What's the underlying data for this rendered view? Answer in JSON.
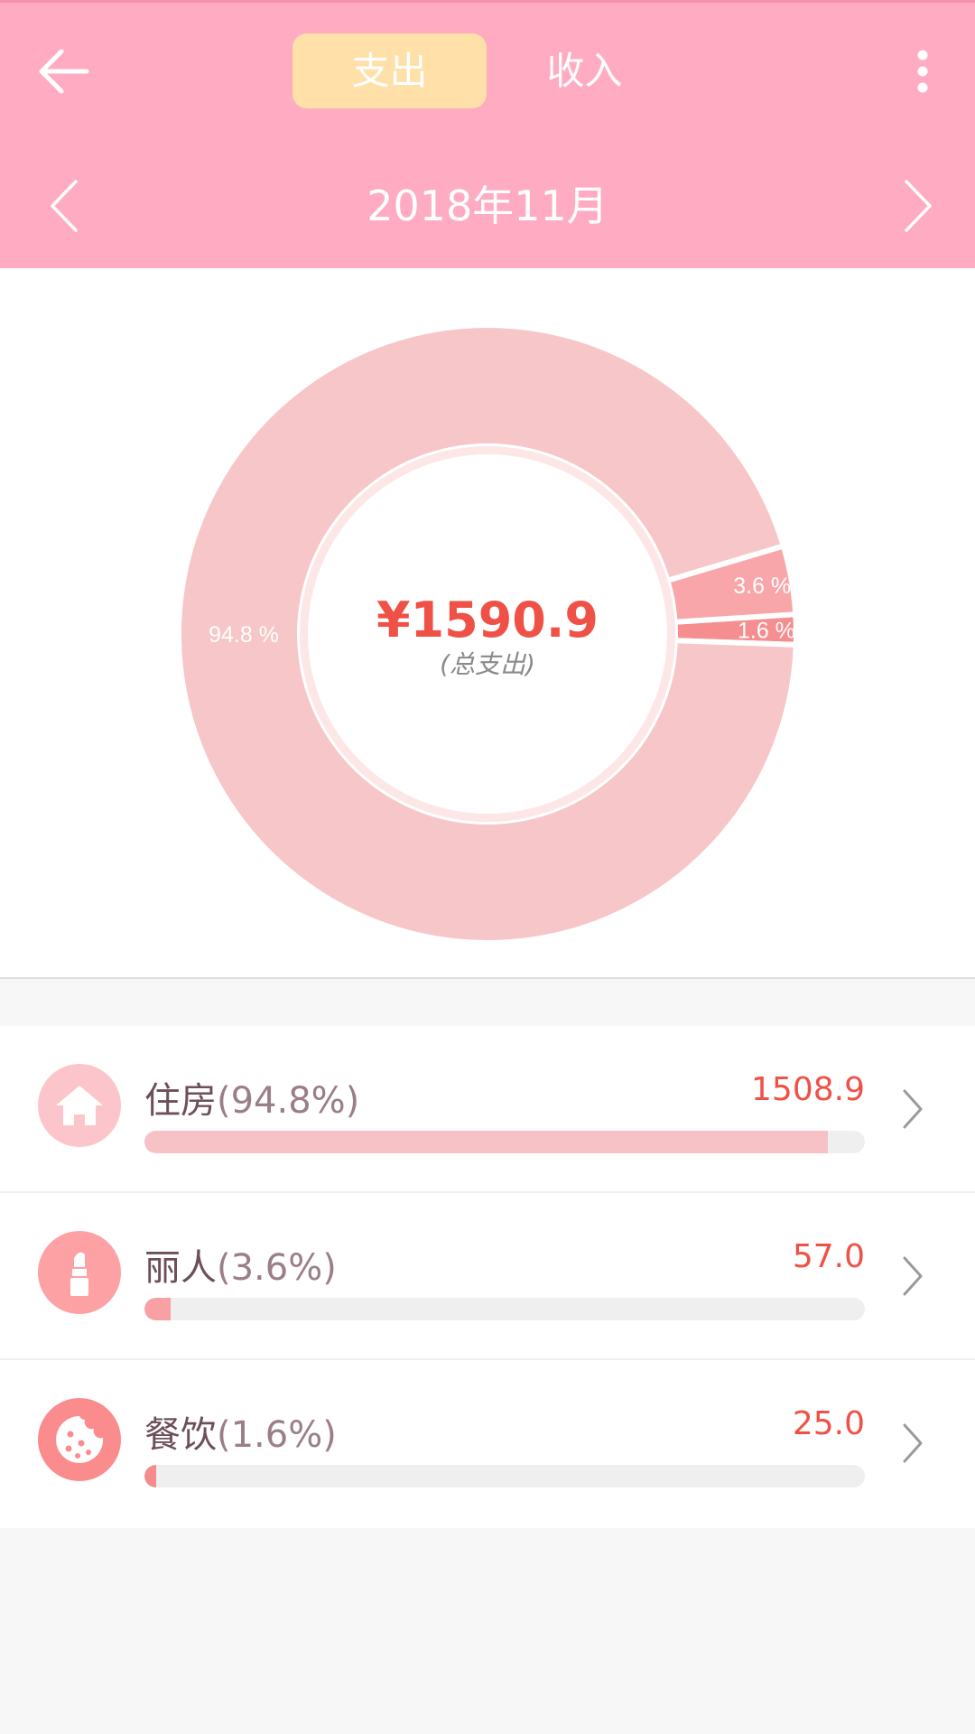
{
  "header": {
    "tabs": [
      {
        "label": "支出",
        "active": true
      },
      {
        "label": "收入",
        "active": false
      }
    ],
    "month": "2018年11月"
  },
  "summary": {
    "total": "¥1590.9",
    "caption": "(总支出)"
  },
  "chart_data": {
    "type": "pie",
    "total": 1590.9,
    "slices": [
      {
        "name": "住房",
        "value": 1508.9,
        "percent_label": "94.8 %",
        "color": "#f7c6c8"
      },
      {
        "name": "丽人",
        "value": 57.0,
        "percent_label": "3.6 %",
        "color": "#f8a6a9"
      },
      {
        "name": "餐饮",
        "value": 25.0,
        "percent_label": "1.6 %",
        "color": "#f68e8f"
      }
    ]
  },
  "categories": [
    {
      "name": "住房",
      "percent": "(94.8%)",
      "amount": "1508.9",
      "fraction": 0.948,
      "icon": "house-icon",
      "icon_color": "#fcc5cb",
      "bar_color": "#f7c2c5"
    },
    {
      "name": "丽人",
      "percent": "(3.6%)",
      "amount": "57.0",
      "fraction": 0.036,
      "icon": "lipstick-icon",
      "icon_color": "#fda1a4",
      "bar_color": "#f8a0a3"
    },
    {
      "name": "餐饮",
      "percent": "(1.6%)",
      "amount": "25.0",
      "fraction": 0.016,
      "icon": "cookie-icon",
      "icon_color": "#fb8c8d",
      "bar_color": "#f58b8d"
    }
  ]
}
